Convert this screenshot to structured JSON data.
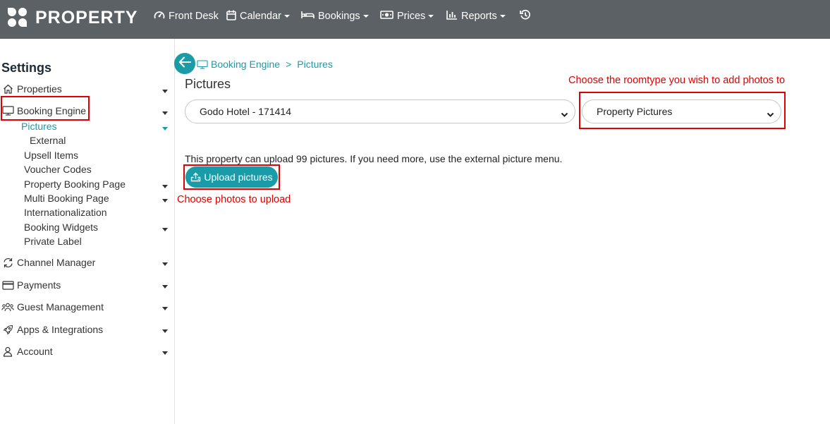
{
  "header": {
    "brand": "PROPERTY",
    "nav": [
      {
        "label": "Front Desk",
        "icon": "gauge-icon",
        "dropdown": false
      },
      {
        "label": "Calendar",
        "icon": "calendar-icon",
        "dropdown": true
      },
      {
        "label": "Bookings",
        "icon": "bed-icon",
        "dropdown": true
      },
      {
        "label": "Prices",
        "icon": "money-icon",
        "dropdown": true
      },
      {
        "label": "Reports",
        "icon": "bar-chart-icon",
        "dropdown": true
      }
    ],
    "history_icon": "history-icon"
  },
  "sidebar": {
    "title": "Settings",
    "items": [
      {
        "label": "Properties",
        "icon": "home-icon"
      },
      {
        "label": "Booking Engine",
        "icon": "monitor-icon"
      },
      {
        "label": "Channel Manager",
        "icon": "sync-icon"
      },
      {
        "label": "Payments",
        "icon": "credit-card-icon"
      },
      {
        "label": "Guest Management",
        "icon": "people-icon"
      },
      {
        "label": "Apps & Integrations",
        "icon": "rocket-icon"
      },
      {
        "label": "Account",
        "icon": "user-icon"
      }
    ],
    "booking_engine_sub": [
      {
        "label": "Pictures"
      },
      {
        "label": "External"
      },
      {
        "label": "Upsell Items"
      },
      {
        "label": "Voucher Codes"
      },
      {
        "label": "Property Booking Page"
      },
      {
        "label": "Multi Booking Page"
      },
      {
        "label": "Internationalization"
      },
      {
        "label": "Booking Widgets"
      },
      {
        "label": "Private Label"
      }
    ]
  },
  "breadcrumb": {
    "root": "Booking Engine",
    "separator": ">",
    "current": "Pictures"
  },
  "page": {
    "title": "Pictures",
    "property_select": "Godo Hotel - 171414",
    "roomtype_select": "Property Pictures",
    "info": "This property can upload 99 pictures. If you need more, use the external picture menu.",
    "upload_label": "Upload pictures"
  },
  "annotations": {
    "roomtype": "Choose the roomtype you wish to add photos to",
    "upload": "Choose photos to upload"
  },
  "colors": {
    "topbar": "#5b6164",
    "accent": "#1a9ba8",
    "annotation": "#e00000"
  }
}
